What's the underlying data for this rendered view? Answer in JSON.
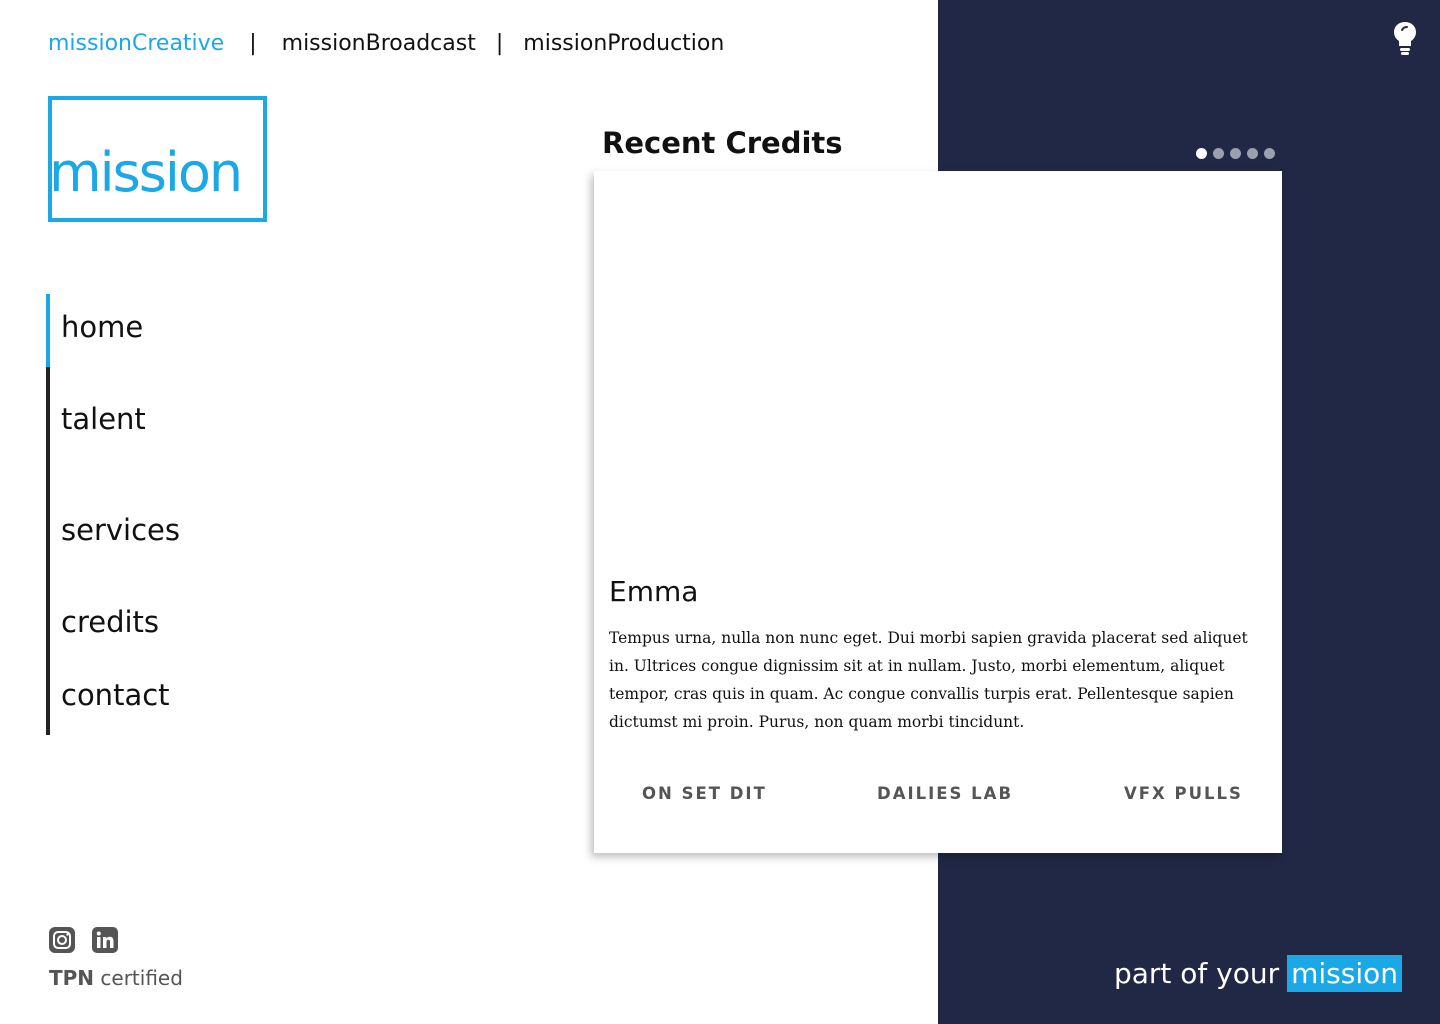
{
  "topnav": {
    "items": [
      "missionCreative",
      "missionBroadcast",
      "missionProduction"
    ],
    "separator": "|"
  },
  "logo": {
    "text": "mission"
  },
  "sidenav": {
    "items": [
      "home",
      "talent",
      "services",
      "credits",
      "contact"
    ],
    "active": "home"
  },
  "section": {
    "title": "Recent Credits"
  },
  "carousel": {
    "slide_count": 5,
    "active_index": 0
  },
  "card": {
    "title": "Emma",
    "body": "Tempus urna, nulla non nunc eget. Dui morbi sapien gravida placerat sed aliquet in. Ultrices congue dignissim sit at in nullam. Justo, morbi elementum, aliquet tempor, cras quis in quam. Ac congue convallis turpis erat. Pellentesque sapien dictumst mi proin. Purus, non quam morbi tincidunt.",
    "tags": [
      "ON SET DIT",
      "DAILIES LAB",
      "VFX PULLS"
    ]
  },
  "footer": {
    "social_icons": [
      "instagram-icon",
      "linkedin-icon"
    ],
    "tpn_bold": "TPN",
    "tpn_rest": "certified"
  },
  "tagline": {
    "prefix": "part of your",
    "highlight": "mission"
  },
  "icons": {
    "top_right": "lightbulb-icon"
  },
  "colors": {
    "accent": "#1ba8e6",
    "navy": "#202846",
    "text": "#111111",
    "muted": "#555555"
  }
}
